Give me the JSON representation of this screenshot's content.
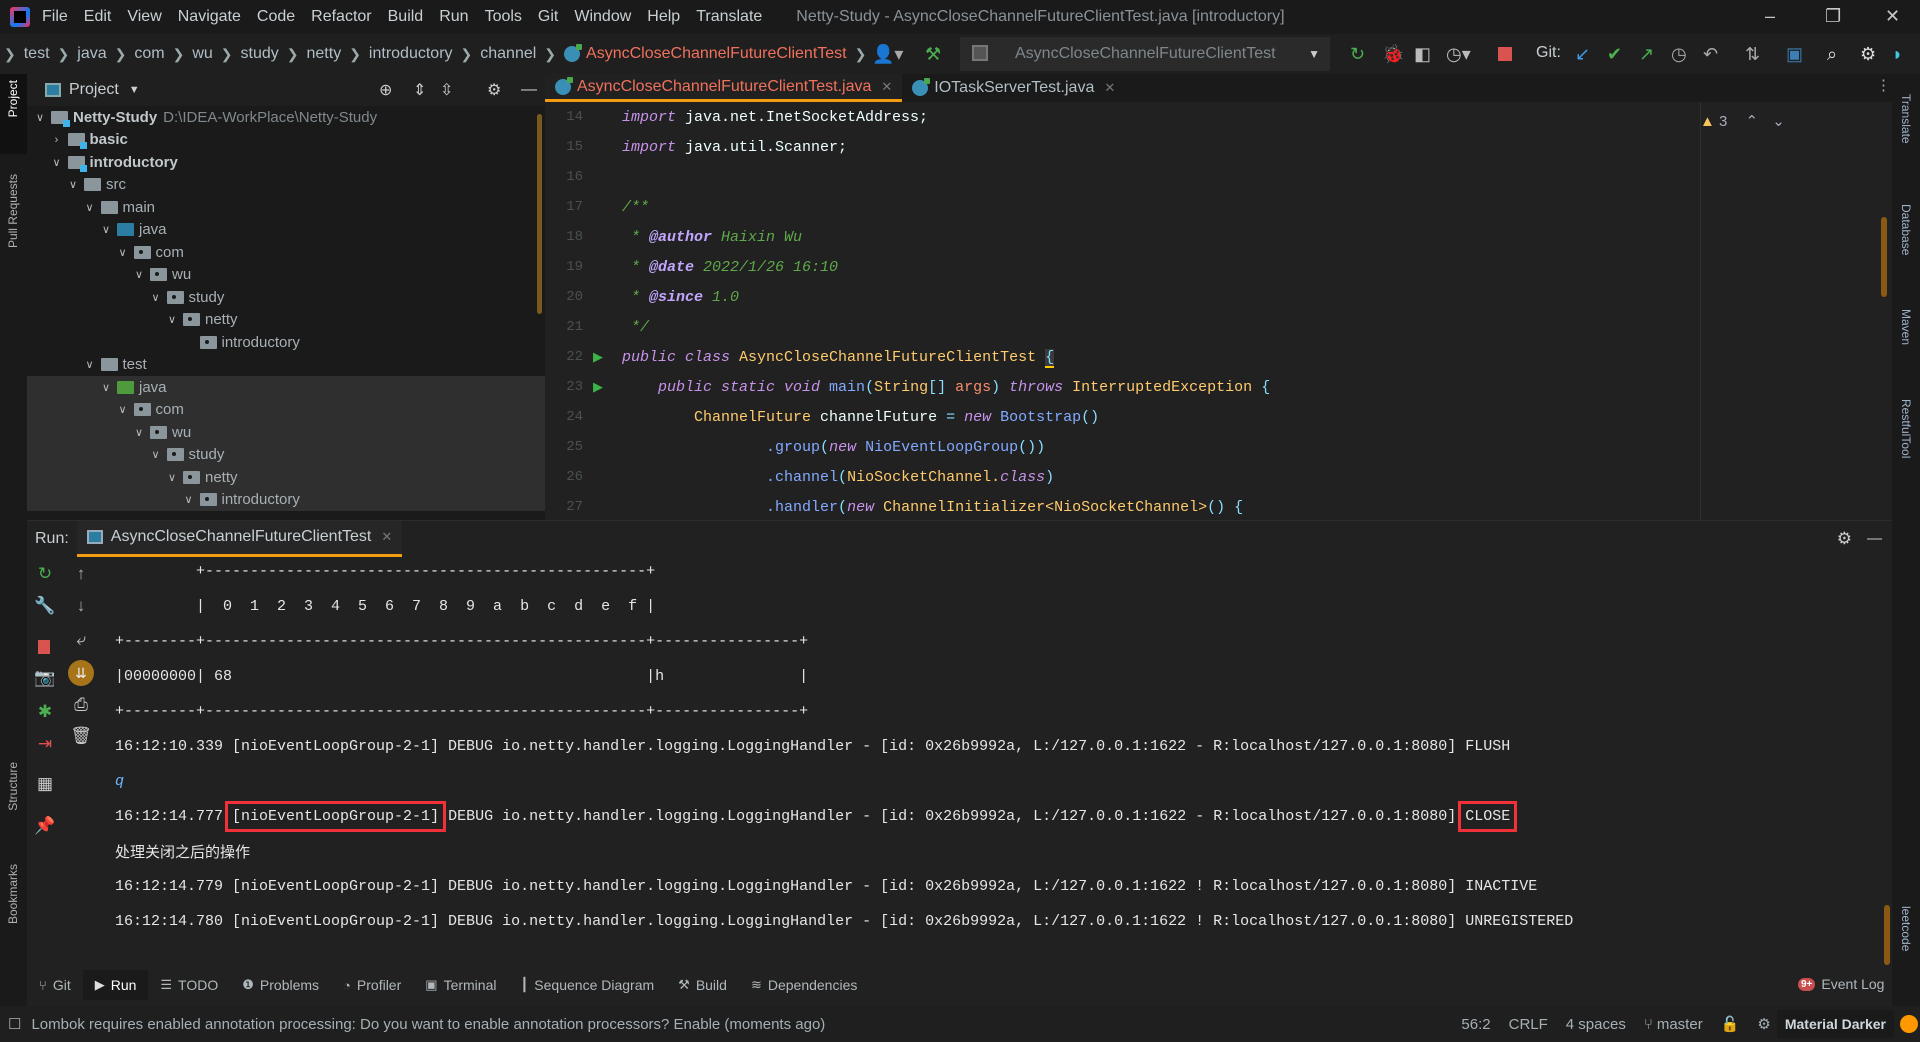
{
  "window": {
    "title": "Netty-Study - AsyncCloseChannelFutureClientTest.java [introductory]",
    "menu": [
      "File",
      "Edit",
      "View",
      "Navigate",
      "Code",
      "Refactor",
      "Build",
      "Run",
      "Tools",
      "Git",
      "Window",
      "Help",
      "Translate"
    ]
  },
  "breadcrumb": [
    "test",
    "java",
    "com",
    "wu",
    "study",
    "netty",
    "introductory",
    "channel",
    "AsyncCloseChannelFutureClientTest"
  ],
  "toolbar": {
    "run_config": "AsyncCloseChannelFutureClientTest",
    "git_label": "Git:"
  },
  "left_strip": [
    "Project",
    "Pull Requests",
    "Structure",
    "Bookmarks"
  ],
  "right_strip": [
    "Translate",
    "Database",
    "Maven",
    "RestfulTool",
    "leetcode"
  ],
  "project": {
    "title": "Project",
    "tree": [
      {
        "name": "Netty-Study",
        "path": "D:\\IDEA-WorkPlace\\Netty-Study",
        "depth": 0,
        "icon": "module",
        "expanded": true,
        "bold": true
      },
      {
        "name": "basic",
        "depth": 1,
        "icon": "module",
        "expanded": false,
        "bold": true
      },
      {
        "name": "introductory",
        "depth": 1,
        "icon": "module",
        "expanded": true,
        "bold": true
      },
      {
        "name": "src",
        "depth": 2,
        "icon": "folder",
        "expanded": true
      },
      {
        "name": "main",
        "depth": 3,
        "icon": "folder",
        "expanded": true
      },
      {
        "name": "java",
        "depth": 4,
        "icon": "source-root",
        "expanded": true
      },
      {
        "name": "com",
        "depth": 5,
        "icon": "package",
        "expanded": true
      },
      {
        "name": "wu",
        "depth": 6,
        "icon": "package",
        "expanded": true
      },
      {
        "name": "study",
        "depth": 7,
        "icon": "package",
        "expanded": true
      },
      {
        "name": "netty",
        "depth": 8,
        "icon": "package",
        "expanded": true
      },
      {
        "name": "introductory",
        "depth": 9,
        "icon": "package",
        "expanded": null
      },
      {
        "name": "test",
        "depth": 3,
        "icon": "folder",
        "expanded": true
      },
      {
        "name": "java",
        "depth": 4,
        "icon": "test-root",
        "expanded": true,
        "selected": true
      },
      {
        "name": "com",
        "depth": 5,
        "icon": "package",
        "expanded": true,
        "selected": true
      },
      {
        "name": "wu",
        "depth": 6,
        "icon": "package",
        "expanded": true,
        "selected": true
      },
      {
        "name": "study",
        "depth": 7,
        "icon": "package",
        "expanded": true,
        "selected": true
      },
      {
        "name": "netty",
        "depth": 8,
        "icon": "package",
        "expanded": true,
        "selected": true
      },
      {
        "name": "introductory",
        "depth": 9,
        "icon": "package",
        "expanded": true,
        "selected": true
      }
    ]
  },
  "editor": {
    "tabs": [
      {
        "label": "AsyncCloseChannelFutureClientTest.java",
        "active": true
      },
      {
        "label": "IOTaskServerTest.java",
        "active": false
      }
    ],
    "warnings": "3",
    "lines": [
      {
        "n": "14",
        "tokens": [
          [
            "kw",
            "import"
          ],
          [
            "id",
            " java.net.InetSocketAddress;"
          ]
        ]
      },
      {
        "n": "15",
        "tokens": [
          [
            "kw",
            "import"
          ],
          [
            "id",
            " java.util.Scanner;"
          ]
        ]
      },
      {
        "n": "16",
        "tokens": []
      },
      {
        "n": "17",
        "tokens": [
          [
            "com",
            "/**"
          ]
        ]
      },
      {
        "n": "18",
        "tokens": [
          [
            "com",
            " * "
          ],
          [
            "tag",
            "@author"
          ],
          [
            "com",
            " Haixin Wu"
          ]
        ]
      },
      {
        "n": "19",
        "tokens": [
          [
            "com",
            " * "
          ],
          [
            "tag",
            "@date"
          ],
          [
            "com",
            " 2022/1/26 16:10"
          ]
        ]
      },
      {
        "n": "20",
        "tokens": [
          [
            "com",
            " * "
          ],
          [
            "tag",
            "@since"
          ],
          [
            "com",
            " 1.0"
          ]
        ]
      },
      {
        "n": "21",
        "tokens": [
          [
            "com",
            " */"
          ]
        ]
      },
      {
        "n": "22",
        "run": true,
        "tokens": [
          [
            "kw",
            "public class "
          ],
          [
            "type",
            "AsyncCloseChannelFutureClientTest "
          ],
          [
            "brace",
            "{"
          ]
        ]
      },
      {
        "n": "23",
        "run": true,
        "tokens": [
          [
            "kw",
            "    public static void "
          ],
          [
            "fn",
            "main"
          ],
          [
            "punc",
            "("
          ],
          [
            "type",
            "String"
          ],
          [
            "punc",
            "[] "
          ],
          [
            "param",
            "args"
          ],
          [
            "punc",
            ") "
          ],
          [
            "kw",
            "throws "
          ],
          [
            "type",
            "InterruptedException "
          ],
          [
            "punc",
            "{"
          ]
        ]
      },
      {
        "n": "24",
        "tokens": [
          [
            "type",
            "        ChannelFuture "
          ],
          [
            "id",
            "channelFuture "
          ],
          [
            "punc",
            "= "
          ],
          [
            "kw",
            "new "
          ],
          [
            "fn",
            "Bootstrap"
          ],
          [
            "punc",
            "()"
          ]
        ]
      },
      {
        "n": "25",
        "tokens": [
          [
            "fn",
            "                .group"
          ],
          [
            "punc",
            "("
          ],
          [
            "kw",
            "new "
          ],
          [
            "fn",
            "NioEventLoopGroup"
          ],
          [
            "punc",
            "())"
          ]
        ]
      },
      {
        "n": "26",
        "tokens": [
          [
            "fn",
            "                .channel"
          ],
          [
            "punc",
            "("
          ],
          [
            "type",
            "NioSocketChannel."
          ],
          [
            "kw",
            "class"
          ],
          [
            "punc",
            ")"
          ]
        ]
      },
      {
        "n": "27",
        "tokens": [
          [
            "fn",
            "                .handler"
          ],
          [
            "punc",
            "("
          ],
          [
            "kw",
            "new "
          ],
          [
            "type",
            "ChannelInitializer<NioSocketChannel>"
          ],
          [
            "punc",
            "() {"
          ]
        ]
      }
    ]
  },
  "run": {
    "label": "Run:",
    "tab": "AsyncCloseChannelFutureClientTest",
    "console": [
      {
        "segments": [
          {
            "text": "         +-------------------------------------------------+"
          }
        ]
      },
      {
        "segments": [
          {
            "text": "         |  0  1  2  3  4  5  6  7  8  9  a  b  c  d  e  f |"
          }
        ]
      },
      {
        "segments": [
          {
            "text": "+--------+-------------------------------------------------+----------------+"
          }
        ]
      },
      {
        "segments": [
          {
            "text": "|00000000| 68                                              |h               |"
          }
        ]
      },
      {
        "segments": [
          {
            "text": "+--------+-------------------------------------------------+----------------+"
          }
        ]
      },
      {
        "segments": [
          {
            "text": "16:12:10.339 [nioEventLoopGroup-2-1] DEBUG io.netty.handler.logging.LoggingHandler - [id: 0x26b9992a, L:/127.0.0.1:1622 - R:localhost/127.0.0.1:8080] FLUSH"
          }
        ]
      },
      {
        "input": true,
        "segments": [
          {
            "text": "q"
          }
        ]
      },
      {
        "segments": [
          {
            "text": "16:12:14.777 "
          },
          {
            "text": "[nioEventLoopGroup-2-1]",
            "highlight": true
          },
          {
            "text": " DEBUG io.netty.handler.logging.LoggingHandler - [id: 0x26b9992a, L:/127.0.0.1:1622 - R:localhost/127.0.0.1:8080] "
          },
          {
            "text": "CLOSE",
            "highlight": true
          }
        ]
      },
      {
        "segments": [
          {
            "text": "处理关闭之后的操作"
          }
        ]
      },
      {
        "segments": [
          {
            "text": "16:12:14.779 [nioEventLoopGroup-2-1] DEBUG io.netty.handler.logging.LoggingHandler - [id: 0x26b9992a, L:/127.0.0.1:1622 ! R:localhost/127.0.0.1:8080] INACTIVE"
          }
        ]
      },
      {
        "segments": [
          {
            "text": "16:12:14.780 [nioEventLoopGroup-2-1] DEBUG io.netty.handler.logging.LoggingHandler - [id: 0x26b9992a, L:/127.0.0.1:1622 ! R:localhost/127.0.0.1:8080] UNREGISTERED"
          }
        ]
      }
    ],
    "highlight_color": "#f0313a"
  },
  "tool_tabs": [
    {
      "label": "Git",
      "icon": "git-branch-icon",
      "glyph": "⑂"
    },
    {
      "label": "Run",
      "icon": "run-icon",
      "glyph": "▶",
      "active": true
    },
    {
      "label": "TODO",
      "icon": "list-icon",
      "glyph": "☰"
    },
    {
      "label": "Problems",
      "icon": "problems-icon",
      "glyph": "❶"
    },
    {
      "label": "Profiler",
      "icon": "profiler-icon",
      "glyph": "◔"
    },
    {
      "label": "Terminal",
      "icon": "terminal-icon",
      "glyph": "▣"
    },
    {
      "label": "Sequence Diagram",
      "icon": "sequence-diagram-icon",
      "glyph": "┃"
    },
    {
      "label": "Build",
      "icon": "hammer-icon",
      "glyph": "⚒"
    },
    {
      "label": "Dependencies",
      "icon": "dependencies-icon",
      "glyph": "≋"
    }
  ],
  "event_log": {
    "label": "Event Log",
    "badge": "9+"
  },
  "status": {
    "message": "Lombok requires enabled annotation processing: Do you want to enable annotation processors? Enable (moments ago)",
    "position": "56:2",
    "line_sep": "CRLF",
    "indent": "4 spaces",
    "branch": "master",
    "theme": "Material Darker"
  },
  "colors": {
    "accent": "#f39c12",
    "error_file": "#f0715c",
    "background": "#212121"
  }
}
